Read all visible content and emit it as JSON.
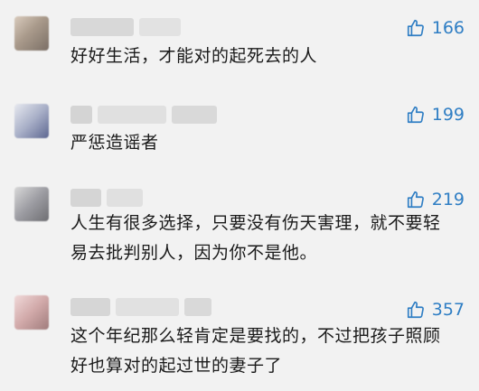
{
  "comments": [
    {
      "likes": "166",
      "text": "好好生活，才能对的起死去的人",
      "avatar_colors": [
        "#c9b9a8",
        "#8a7f74"
      ]
    },
    {
      "likes": "199",
      "text": "严惩造谣者",
      "avatar_colors": [
        "#c8ccd8",
        "#6f7aa0"
      ]
    },
    {
      "likes": "219",
      "text": " 人生有很多选择，只要没有伤天害理，就不要轻易去批判别人，因为你不是他。",
      "avatar_colors": [
        "#c4c4c4",
        "#7d7d80"
      ]
    },
    {
      "likes": "357",
      "text": "这个年纪那么轻肯定是要找的，不过把孩子照顾好也算对的起过世的妻子了",
      "avatar_colors": [
        "#e3c8c8",
        "#b08a8a"
      ]
    }
  ],
  "icons": {
    "like": "thumbs-up-icon"
  },
  "colors": {
    "accent": "#2f7ec4",
    "text": "#1a1a1a",
    "background": "#f2f2f2"
  }
}
